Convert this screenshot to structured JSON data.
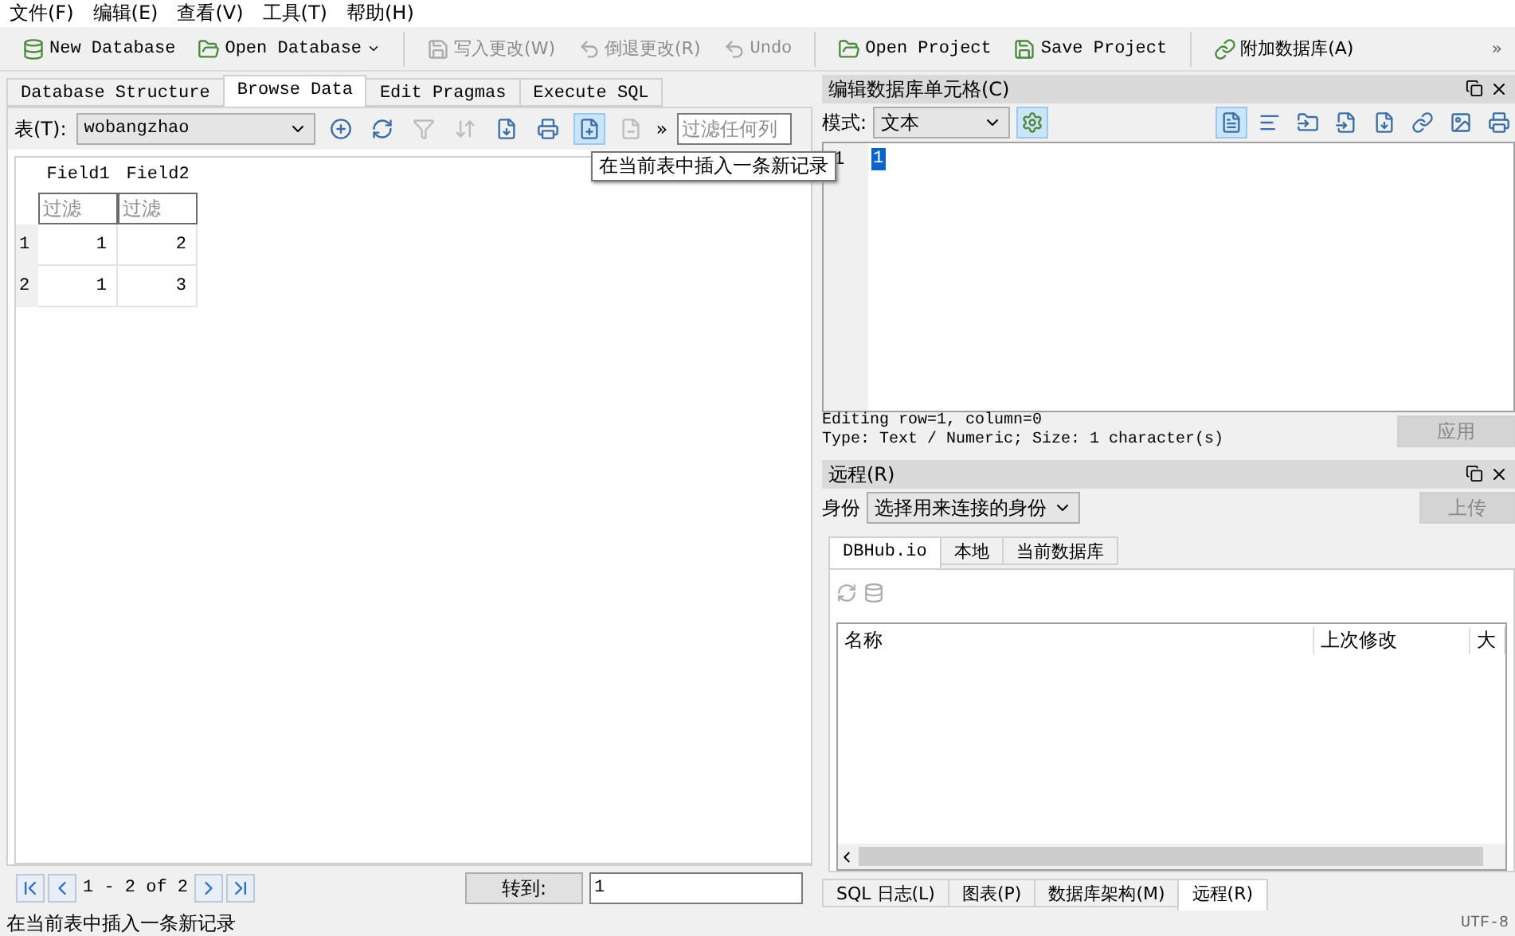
{
  "menu": [
    "文件(F)",
    "编辑(E)",
    "查看(V)",
    "工具(T)",
    "帮助(H)"
  ],
  "toolbar": [
    {
      "kind": "button",
      "label": "New Database",
      "disabled": false
    },
    {
      "kind": "button",
      "label": "Open Database",
      "disabled": false,
      "dropdown": true
    },
    {
      "kind": "separator"
    },
    {
      "kind": "button",
      "label": "写入更改(W)",
      "disabled": true
    },
    {
      "kind": "button",
      "label": "倒退更改(R)",
      "disabled": true
    },
    {
      "kind": "button",
      "label": "Undo",
      "disabled": true
    },
    {
      "kind": "separator"
    },
    {
      "kind": "button",
      "label": "Open Project",
      "disabled": false
    },
    {
      "kind": "button",
      "label": "Save Project",
      "disabled": false
    },
    {
      "kind": "separator"
    },
    {
      "kind": "button",
      "label": "附加数据库(A)",
      "disabled": false
    },
    {
      "kind": "overflow",
      "label": "»"
    }
  ],
  "main_tabs": [
    {
      "label": "Database Structure",
      "selected": false
    },
    {
      "label": "Browse Data",
      "selected": true
    },
    {
      "label": "Edit Pragmas",
      "selected": false
    },
    {
      "label": "Execute SQL",
      "selected": false
    }
  ],
  "browse": {
    "table_label": "表(T):",
    "table_value": "wobangzhao",
    "tools": [
      {
        "disabled": false,
        "selected": false
      },
      {
        "disabled": false,
        "selected": false
      },
      {
        "disabled": true,
        "selected": false
      },
      {
        "disabled": true,
        "selected": false
      },
      {
        "disabled": false,
        "selected": false
      },
      {
        "disabled": false,
        "selected": false
      },
      {
        "disabled": false,
        "selected": true
      },
      {
        "disabled": true,
        "selected": false
      }
    ],
    "overflow": "»",
    "filter_placeholder": "过滤任何列",
    "tooltip": "在当前表中插入一条新记录",
    "columns": [
      "Field1",
      "Field2"
    ],
    "column_filters": [
      {
        "placeholder": "过滤"
      },
      {
        "placeholder": "过滤"
      }
    ],
    "rows": [
      {
        "index": "1",
        "cells": [
          "1",
          "2"
        ]
      },
      {
        "index": "2",
        "cells": [
          "1",
          "3"
        ]
      }
    ],
    "pager": {
      "text": "1 - 2 of 2",
      "goto_label": "转到:",
      "goto_value": "1"
    }
  },
  "edit_cell": {
    "title": "编辑数据库单元格(C)",
    "mode_label": "模式:",
    "mode_value": "文本",
    "line_number": "1",
    "content": "1",
    "info": [
      "Editing row=1, column=0",
      "Type: Text / Numeric; Size: 1 character(s)"
    ],
    "apply": {
      "label": "应用",
      "disabled": true
    }
  },
  "remote": {
    "title": "远程(R)",
    "identity_label": "身份",
    "identity_value": "选择用来连接的身份",
    "upload": {
      "label": "上传",
      "disabled": true
    },
    "tabs": [
      {
        "label": "DBHub.io",
        "selected": true
      },
      {
        "label": "本地",
        "selected": false
      },
      {
        "label": "当前数据库",
        "selected": false
      }
    ],
    "columns": [
      "名称",
      "上次修改",
      "大"
    ]
  },
  "bottom_tabs": [
    {
      "label": "SQL 日志(L)",
      "selected": false
    },
    {
      "label": "图表(P)",
      "selected": false
    },
    {
      "label": "数据库架构(M)",
      "selected": false
    },
    {
      "label": "远程(R)",
      "selected": true
    }
  ],
  "status_bar": {
    "message": "在当前表中插入一条新记录",
    "encoding": "UTF-8"
  }
}
